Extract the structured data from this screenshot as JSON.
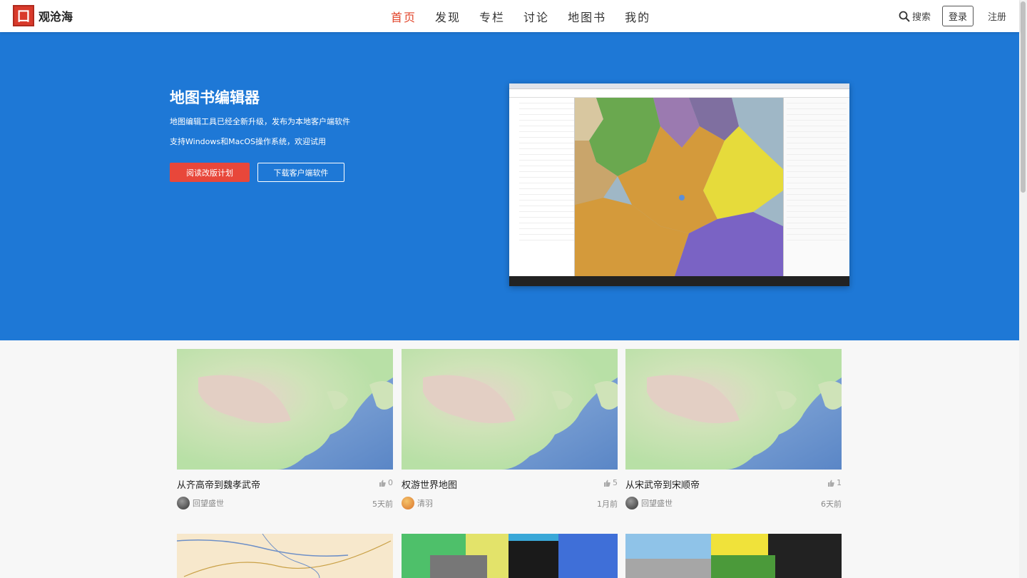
{
  "header": {
    "logo_text": "观沧海",
    "nav": [
      "首页",
      "发现",
      "专栏",
      "讨论",
      "地图书",
      "我的"
    ],
    "active_nav": "首页",
    "search_label": "搜索",
    "login_label": "登录",
    "register_label": "注册"
  },
  "hero": {
    "title": "地图书编辑器",
    "desc1": "地图编辑工具已经全新升级，发布为本地客户端软件",
    "desc2": "支持Windows和MacOS操作系统，欢迎试用",
    "btn_primary": "阅读改版计划",
    "btn_secondary": "下载客户端软件",
    "colors": {
      "background": "#1e78d6",
      "primary_button": "#e8473a"
    }
  },
  "cards": [
    {
      "title": "从齐高帝到魏孝武帝",
      "likes": "0",
      "author": "回望盛世",
      "time": "5天前"
    },
    {
      "title": "权游世界地图",
      "likes": "5",
      "author": "清羽",
      "time": "1月前"
    },
    {
      "title": "从宋武帝到宋顺帝",
      "likes": "1",
      "author": "回望盛世",
      "time": "6天前"
    }
  ],
  "colors": {
    "accent": "#e2462c"
  }
}
